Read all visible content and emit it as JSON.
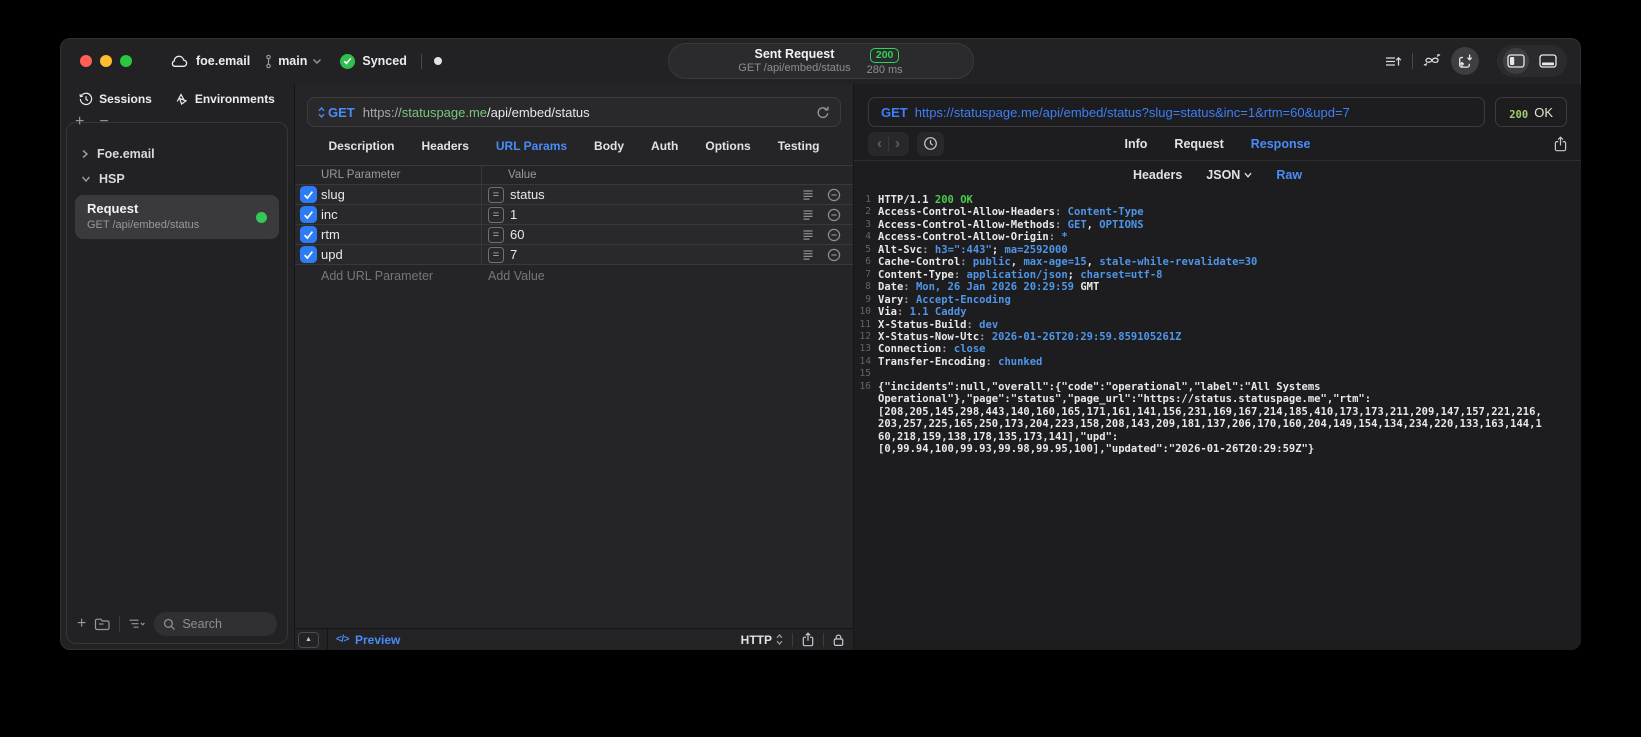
{
  "titlebar": {
    "project_name": "foe.email",
    "branch_name": "main",
    "sync_label": "Synced",
    "request_summary": {
      "title": "Sent Request",
      "status_code": "200",
      "method_path": "GET /api/embed/status",
      "duration": "280 ms"
    }
  },
  "sidebar": {
    "tab_sessions": "Sessions",
    "tab_environments": "Environments",
    "tree_group_1": "Foe.email",
    "tree_group_2": "HSP",
    "request_item": {
      "title": "Request",
      "subtitle": "GET /api/embed/status"
    },
    "search_placeholder": "Search"
  },
  "request_editor": {
    "method": "GET",
    "url_scheme": "https://",
    "url_host": "statuspage.me",
    "url_path": "/api/embed/status",
    "tabs": [
      {
        "label": "Description",
        "active": false
      },
      {
        "label": "Headers",
        "active": false
      },
      {
        "label": "URL Params",
        "active": true
      },
      {
        "label": "Body",
        "active": false
      },
      {
        "label": "Auth",
        "active": false
      },
      {
        "label": "Options",
        "active": false
      },
      {
        "label": "Testing",
        "active": false
      }
    ],
    "table": {
      "col_param": "URL Parameter",
      "col_value": "Value",
      "rows": [
        {
          "checked": true,
          "name": "slug",
          "value": "status"
        },
        {
          "checked": true,
          "name": "inc",
          "value": "1"
        },
        {
          "checked": true,
          "name": "rtm",
          "value": "60"
        },
        {
          "checked": true,
          "name": "upd",
          "value": "7"
        }
      ],
      "add_param": "Add URL Parameter",
      "add_value": "Add Value"
    },
    "footer": {
      "code_glyph": "</>",
      "preview": "Preview",
      "protocol": "HTTP"
    }
  },
  "response_viewer": {
    "request_line": {
      "method": "GET",
      "url": "https://statuspage.me/api/embed/status?slug=status&inc=1&rtm=60&upd=7"
    },
    "status": {
      "code": "200",
      "text": "OK"
    },
    "tabs": [
      {
        "label": "Info",
        "active": false
      },
      {
        "label": "Request",
        "active": false
      },
      {
        "label": "Response",
        "active": true
      }
    ],
    "subtabs": [
      {
        "label": "Headers",
        "active": false,
        "dropdown": false
      },
      {
        "label": "JSON",
        "active": false,
        "dropdown": true
      },
      {
        "label": "Raw",
        "active": true,
        "dropdown": false
      }
    ],
    "code_lines": [
      {
        "num": "1",
        "segments": [
          {
            "t": "HTTP/1.1 ",
            "c": "k"
          },
          {
            "t": "200 OK",
            "c": "g"
          }
        ]
      },
      {
        "num": "2",
        "segments": [
          {
            "t": "Access-Control-Allow-Headers",
            "c": "k"
          },
          {
            "t": ": ",
            "c": "p"
          },
          {
            "t": "Content-Type",
            "c": "v"
          }
        ]
      },
      {
        "num": "3",
        "segments": [
          {
            "t": "Access-Control-Allow-Methods",
            "c": "k"
          },
          {
            "t": ": ",
            "c": "p"
          },
          {
            "t": "GET",
            "c": "v"
          },
          {
            "t": ", ",
            "c": "k"
          },
          {
            "t": "OPTIONS",
            "c": "v"
          }
        ]
      },
      {
        "num": "4",
        "segments": [
          {
            "t": "Access-Control-Allow-Origin",
            "c": "k"
          },
          {
            "t": ": ",
            "c": "p"
          },
          {
            "t": "*",
            "c": "v"
          }
        ]
      },
      {
        "num": "5",
        "segments": [
          {
            "t": "Alt-Svc",
            "c": "k"
          },
          {
            "t": ": ",
            "c": "p"
          },
          {
            "t": "h3=\":443\"",
            "c": "v"
          },
          {
            "t": "; ",
            "c": "k"
          },
          {
            "t": "ma=2592000",
            "c": "v"
          }
        ]
      },
      {
        "num": "6",
        "segments": [
          {
            "t": "Cache-Control",
            "c": "k"
          },
          {
            "t": ": ",
            "c": "p"
          },
          {
            "t": "public",
            "c": "v"
          },
          {
            "t": ", ",
            "c": "k"
          },
          {
            "t": "max-age=15",
            "c": "v"
          },
          {
            "t": ", ",
            "c": "k"
          },
          {
            "t": "stale-while-revalidate=30",
            "c": "v"
          }
        ]
      },
      {
        "num": "7",
        "segments": [
          {
            "t": "Content-Type",
            "c": "k"
          },
          {
            "t": ": ",
            "c": "p"
          },
          {
            "t": "application/json",
            "c": "v"
          },
          {
            "t": "; ",
            "c": "k"
          },
          {
            "t": "charset=utf-8",
            "c": "v"
          }
        ]
      },
      {
        "num": "8",
        "segments": [
          {
            "t": "Date",
            "c": "k"
          },
          {
            "t": ": ",
            "c": "p"
          },
          {
            "t": "Mon, 26 Jan 2026 20:29:59 ",
            "c": "v"
          },
          {
            "t": "GMT",
            "c": "k"
          }
        ]
      },
      {
        "num": "9",
        "segments": [
          {
            "t": "Vary",
            "c": "k"
          },
          {
            "t": ": ",
            "c": "p"
          },
          {
            "t": "Accept-Encoding",
            "c": "v"
          }
        ]
      },
      {
        "num": "10",
        "segments": [
          {
            "t": "Via",
            "c": "k"
          },
          {
            "t": ": ",
            "c": "p"
          },
          {
            "t": "1.1 Caddy",
            "c": "v"
          }
        ]
      },
      {
        "num": "11",
        "segments": [
          {
            "t": "X-Status-Build",
            "c": "k"
          },
          {
            "t": ": ",
            "c": "p"
          },
          {
            "t": "dev",
            "c": "v"
          }
        ]
      },
      {
        "num": "12",
        "segments": [
          {
            "t": "X-Status-Now-Utc",
            "c": "k"
          },
          {
            "t": ": ",
            "c": "p"
          },
          {
            "t": "2026-01-26T20:29:59.859105261Z",
            "c": "v"
          }
        ]
      },
      {
        "num": "13",
        "segments": [
          {
            "t": "Connection",
            "c": "k"
          },
          {
            "t": ": ",
            "c": "p"
          },
          {
            "t": "close",
            "c": "v"
          }
        ]
      },
      {
        "num": "14",
        "segments": [
          {
            "t": "Transfer-Encoding",
            "c": "k"
          },
          {
            "t": ": ",
            "c": "p"
          },
          {
            "t": "chunked",
            "c": "v"
          }
        ]
      },
      {
        "num": "15",
        "segments": []
      },
      {
        "num": "16",
        "segments": [
          {
            "t": "{\"incidents\":null,\"overall\":{\"code\":\"operational\",\"label\":\"All Systems ",
            "c": "k"
          }
        ]
      },
      {
        "num": "",
        "segments": [
          {
            "t": "Operational\"},\"page\":\"status\",\"page_url\":\"https://status.statuspage.me\",\"rtm\":",
            "c": "k"
          }
        ]
      },
      {
        "num": "",
        "segments": [
          {
            "t": "[208,205,145,298,443,140,160,165,171,161,141,156,231,169,167,214,185,410,173,173,211,209,147,157,221,216,",
            "c": "k"
          }
        ]
      },
      {
        "num": "",
        "segments": [
          {
            "t": "203,257,225,165,250,173,204,223,158,208,143,209,181,137,206,170,160,204,149,154,134,234,220,133,163,144,1",
            "c": "k"
          }
        ]
      },
      {
        "num": "",
        "segments": [
          {
            "t": "60,218,159,138,178,135,173,141],\"upd\":",
            "c": "k"
          }
        ]
      },
      {
        "num": "",
        "segments": [
          {
            "t": "[0,99.94,100,99.93,99.98,99.95,100],\"updated\":\"2026-01-26T20:29:59Z\"}",
            "c": "k"
          }
        ]
      }
    ]
  },
  "icons": {
    "collapse_arrow": "▲",
    "back": "‹",
    "forward": "›",
    "plus": "+",
    "minus": "−",
    "equals": "="
  },
  "colors": {
    "accent_blue": "#4a8cf7",
    "badge_green": "#30d158",
    "status_text_green": "#a3cd6d",
    "url_host_green": "#79c779",
    "code_value_blue": "#4f96e8",
    "code_status_green": "#4ccb4c"
  }
}
